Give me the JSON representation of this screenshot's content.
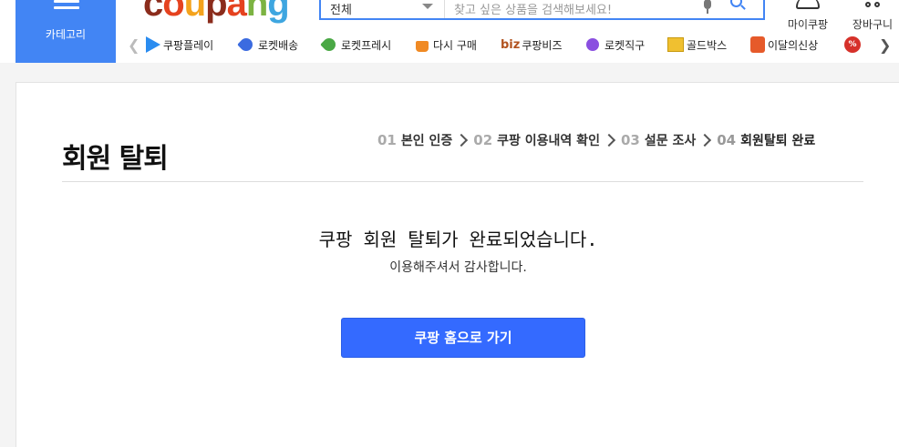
{
  "header": {
    "category_label": "카테고리",
    "logo": [
      "c",
      "o",
      "u",
      "p",
      "a",
      "n",
      "g"
    ],
    "search": {
      "category_value": "전체",
      "placeholder": "찾고 싶은 상품을 검색해보세요!"
    },
    "my_coupang": "마이쿠팡",
    "cart": "장바구니"
  },
  "quick_menu": [
    {
      "label": "쿠팡플레이",
      "icon": "play-icon"
    },
    {
      "label": "로켓배송",
      "icon": "rocket-icon"
    },
    {
      "label": "로켓프레시",
      "icon": "rocket-fresh-icon"
    },
    {
      "label": "다시 구매",
      "icon": "shopping-bag-icon"
    },
    {
      "label": "쿠팡비즈",
      "icon": "biz-icon"
    },
    {
      "label": "로켓직구",
      "icon": "rocket-direct-icon"
    },
    {
      "label": "골드박스",
      "icon": "gold-box-icon"
    },
    {
      "label": "이달의신상",
      "icon": "new-arrivals-icon"
    },
    {
      "label": "",
      "icon": "discount-icon"
    }
  ],
  "page": {
    "title": "회원 탈퇴",
    "steps": [
      {
        "num": "01",
        "label": "본인 인증"
      },
      {
        "num": "02",
        "label": "쿠팡 이용내역 확인"
      },
      {
        "num": "03",
        "label": "설문 조사"
      },
      {
        "num": "04",
        "label": "회원탈퇴 완료"
      }
    ],
    "done_title": "쿠팡 회원 탈퇴가 완료되었습니다.",
    "done_sub": "이용해주셔서 감사합니다.",
    "home_button": "쿠팡 홈으로 가기"
  },
  "colors": {
    "accent": "#4285f4",
    "button": "#346aff"
  }
}
